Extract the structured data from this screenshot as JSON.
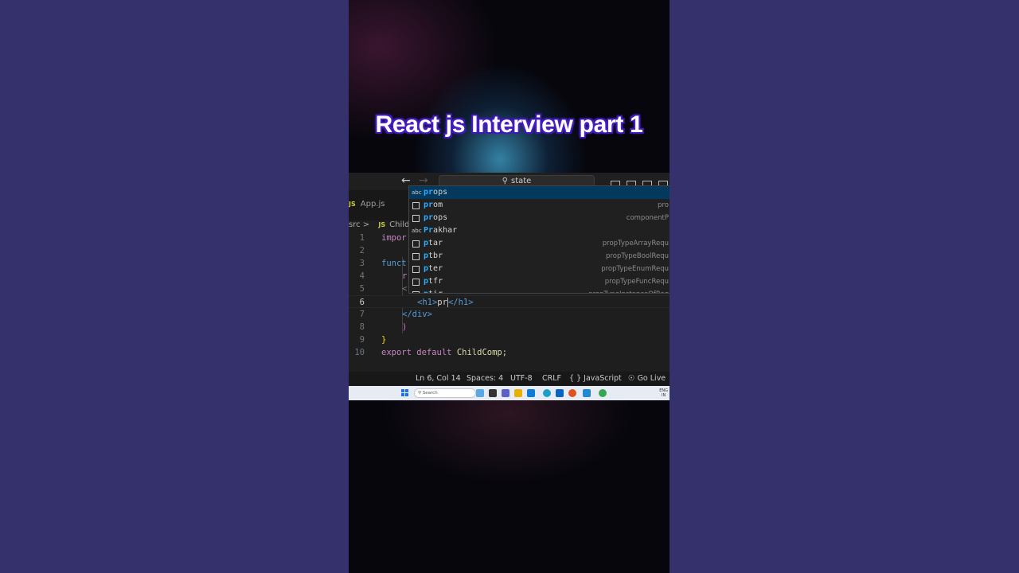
{
  "video": {
    "title": "React js Interview part 1"
  },
  "editor": {
    "search_text": "state",
    "tab_label": "App.js",
    "file_badge": "JS",
    "breadcrumb": {
      "folder": "src",
      "separator": ">",
      "file": "Childc"
    },
    "code_lines": [
      {
        "num": "1",
        "text": "impor"
      },
      {
        "num": "2",
        "text": ""
      },
      {
        "num": "3",
        "text": "funct"
      },
      {
        "num": "4",
        "text": "r"
      },
      {
        "num": "5",
        "text": "<"
      },
      {
        "num": "6",
        "open": "<h1>",
        "typed": "pr",
        "close": "</h1>"
      },
      {
        "num": "7",
        "text": "</div>"
      },
      {
        "num": "8",
        "text": ")"
      },
      {
        "num": "9",
        "text": "}"
      },
      {
        "num": "10",
        "kw": "export default",
        "ident": "ChildComp;"
      }
    ],
    "suggestions": [
      {
        "icon": "abc",
        "match": "pr",
        "rest": "ops",
        "detail": ""
      },
      {
        "icon": "box",
        "match": "pr",
        "rest": "om",
        "detail": "pro"
      },
      {
        "icon": "box",
        "match": "pr",
        "rest": "ops",
        "detail": "componentP"
      },
      {
        "icon": "abc",
        "match": "Pr",
        "rest": "akhar",
        "detail": ""
      },
      {
        "icon": "box",
        "match": "p",
        "rest": "tar",
        "detail": "propTypeArrayRequ"
      },
      {
        "icon": "box",
        "match": "p",
        "rest": "tbr",
        "detail": "propTypeBoolRequ"
      },
      {
        "icon": "box",
        "match": "p",
        "rest": "ter",
        "detail": "propTypeEnumRequ"
      },
      {
        "icon": "box",
        "match": "p",
        "rest": "tfr",
        "detail": "propTypeFuncRequ"
      },
      {
        "icon": "box",
        "match": "p",
        "rest": "tir",
        "detail": "propTypeInstanceOfReq"
      }
    ],
    "status": {
      "position": "Ln 6, Col 14",
      "spaces": "Spaces: 4",
      "encoding": "UTF-8",
      "eol": "CRLF",
      "language_icon": "{ }",
      "language": "JavaScript",
      "golive": "Go Live"
    }
  },
  "taskbar": {
    "search_placeholder": "Search",
    "tray_lang": "ENG",
    "tray_region": "IN"
  },
  "colors": {
    "side_bg": "#34316c",
    "editor_bg": "#1e1e1e",
    "accent": "#2aaaff",
    "selected": "#04395e"
  }
}
